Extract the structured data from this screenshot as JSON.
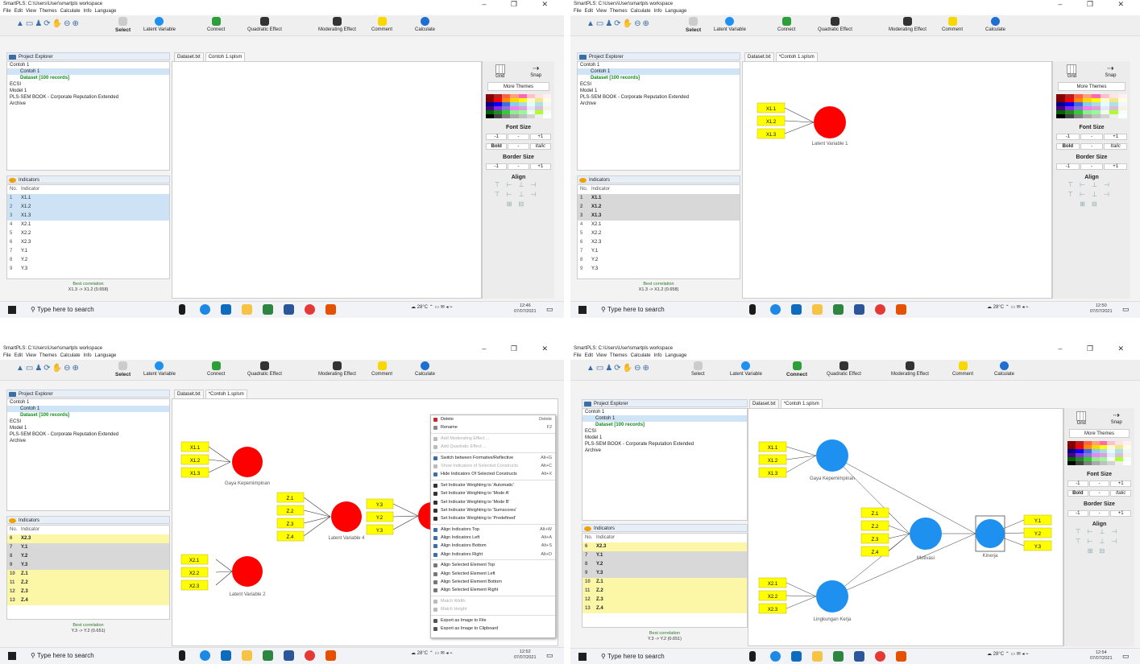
{
  "window": {
    "title": "SmartPLS: C:\\Users\\User\\smartpls workspace",
    "controls": "– ❐ ✕"
  },
  "menu": [
    "File",
    "Edit",
    "View",
    "Themes",
    "Calculate",
    "Info",
    "Language"
  ],
  "toolbar": {
    "select": "Select",
    "latent": "Latent Variable",
    "connect": "Connect",
    "quadratic": "Quadratic Effect",
    "moderating": "Moderating Effect",
    "comment": "Comment",
    "calculate": "Calculate"
  },
  "explorer": {
    "title": "Project Explorer",
    "items": [
      {
        "label": "Contoh 1",
        "cls": ""
      },
      {
        "label": "Contoh 1",
        "cls": "sel"
      },
      {
        "label": "Dataset [100 records]",
        "cls": "green"
      },
      {
        "label": "ECSI",
        "cls": ""
      },
      {
        "label": "Model 1",
        "cls": ""
      },
      {
        "label": "PLS-SEM BOOK - Corporate Reputation Extended",
        "cls": ""
      },
      {
        "label": "Archive",
        "cls": ""
      }
    ]
  },
  "indicators": {
    "title": "Indicators",
    "header_no": "No.",
    "header_label": "Indicator",
    "q1": [
      [
        "1",
        "X1.1",
        "bl"
      ],
      [
        "2",
        "X1.2",
        "bl"
      ],
      [
        "3",
        "X1.3",
        "bl"
      ],
      [
        "4",
        "X2.1",
        ""
      ],
      [
        "5",
        "X2.2",
        ""
      ],
      [
        "6",
        "X2.3",
        ""
      ],
      [
        "7",
        "Y.1",
        ""
      ],
      [
        "8",
        "Y.2",
        ""
      ],
      [
        "9",
        "Y.3",
        ""
      ]
    ],
    "q2": [
      [
        "1",
        "X1.1",
        "gr"
      ],
      [
        "2",
        "X1.2",
        "gr"
      ],
      [
        "3",
        "X1.3",
        "gr"
      ],
      [
        "4",
        "X2.1",
        ""
      ],
      [
        "5",
        "X2.2",
        ""
      ],
      [
        "6",
        "X2.3",
        ""
      ],
      [
        "7",
        "Y.1",
        ""
      ],
      [
        "8",
        "Y.2",
        ""
      ],
      [
        "9",
        "Y.3",
        ""
      ]
    ],
    "q3": [
      [
        "6",
        "X2.3",
        "ye"
      ],
      [
        "7",
        "Y.1",
        "gr"
      ],
      [
        "8",
        "Y.2",
        "gr"
      ],
      [
        "9",
        "Y.3",
        "gr"
      ],
      [
        "10",
        "Z.1",
        "ye"
      ],
      [
        "11",
        "Z.2",
        "ye"
      ],
      [
        "12",
        "Z.3",
        "ye"
      ],
      [
        "13",
        "Z.4",
        "ye"
      ]
    ],
    "q4": [
      [
        "6",
        "X2.3",
        "ye"
      ],
      [
        "7",
        "Y.1",
        "gr"
      ],
      [
        "8",
        "Y.2",
        "gr"
      ],
      [
        "9",
        "Y.3",
        "gr"
      ],
      [
        "10",
        "Z.1",
        "ye"
      ],
      [
        "11",
        "Z.2",
        "ye"
      ],
      [
        "12",
        "Z.3",
        "ye"
      ],
      [
        "13",
        "Z.4",
        "ye"
      ]
    ]
  },
  "best_correlation": {
    "label": "Best correlation",
    "v1": "X1.3 -> X1.2 (0.658)",
    "v2": "X1.3 -> X1.2 (0.658)",
    "v3": "Y.3 -> Y.2 (0.651)",
    "v4": "Y.3 -> Y.2 (0.651)"
  },
  "tabs": {
    "dataset": "Dataset.txt",
    "model1": "Contoh 1.splsm",
    "model2": "*Contoh 1.splsm"
  },
  "props": {
    "grid": "Grid",
    "snap": "Snap",
    "more_themes": "More Themes",
    "font_size": "Font Size",
    "border_size": "Border Size",
    "align": "Align",
    "bold": "Bold",
    "italic": "Italic",
    "minus": "-1",
    "dash": "-",
    "plus": "+1",
    "one": "1"
  },
  "model": {
    "lv1": "Latent Variable 1",
    "gaya": "Gaya Kepemimpinan",
    "lv4": "Latent Variable 4",
    "lv2": "Latent Variable 2",
    "motivasi": "Motivasi",
    "kinerja": "Kinerja",
    "lingkungan": "Lingkungan Kerja",
    "x1": [
      "X1.1",
      "X1.2",
      "X1.3"
    ],
    "x2": [
      "X2.1",
      "X2.2",
      "X2.3"
    ],
    "z": [
      "Z.1",
      "Z.2",
      "Z.3",
      "Z.4"
    ],
    "y": [
      "Y.1",
      "Y.2",
      "Y.3"
    ]
  },
  "context_menu": [
    {
      "label": "Delete",
      "sh": "Delete",
      "c": "#c62828",
      "dis": false,
      "sep": false
    },
    {
      "label": "Rename",
      "sh": "F2",
      "c": "#888",
      "dis": false,
      "sep": true
    },
    {
      "label": "Add Moderating Effect ...",
      "sh": "",
      "c": "#bbb",
      "dis": true,
      "sep": false
    },
    {
      "label": "Add Quadratic Effect ...",
      "sh": "",
      "c": "#bbb",
      "dis": true,
      "sep": true
    },
    {
      "label": "Switch between Formative/Reflective",
      "sh": "Alt+G",
      "c": "#3a6ea5",
      "dis": false,
      "sep": false
    },
    {
      "label": "Show Indicators of Selected Constructs",
      "sh": "Alt+C",
      "c": "#bbb",
      "dis": true,
      "sep": false
    },
    {
      "label": "Hide Indicators Of Selected Constructs",
      "sh": "Alt+X",
      "c": "#3a6ea5",
      "dis": false,
      "sep": true
    },
    {
      "label": "Set Indicator Weighting to 'Automatic'",
      "sh": "",
      "c": "#333",
      "dis": false,
      "sep": false
    },
    {
      "label": "Set Indicator Weighting to 'Mode A'",
      "sh": "",
      "c": "#333",
      "dis": false,
      "sep": false
    },
    {
      "label": "Set Indicator Weighting to 'Mode B'",
      "sh": "",
      "c": "#333",
      "dis": false,
      "sep": false
    },
    {
      "label": "Set Indicator Weighting to 'Sumscores'",
      "sh": "",
      "c": "#333",
      "dis": false,
      "sep": false
    },
    {
      "label": "Set Indicator Weighting to 'Predefined'",
      "sh": "",
      "c": "#333",
      "dis": false,
      "sep": true
    },
    {
      "label": "Align Indicators Top",
      "sh": "Alt+W",
      "c": "#3a6ea5",
      "dis": false,
      "sep": false
    },
    {
      "label": "Align Indicators Left",
      "sh": "Alt+A",
      "c": "#3a6ea5",
      "dis": false,
      "sep": false
    },
    {
      "label": "Align Indicators Bottom",
      "sh": "Alt+S",
      "c": "#3a6ea5",
      "dis": false,
      "sep": false
    },
    {
      "label": "Align Indicators Right",
      "sh": "Alt+D",
      "c": "#3a6ea5",
      "dis": false,
      "sep": true
    },
    {
      "label": "Align Selected Element Top",
      "sh": "",
      "c": "#777",
      "dis": false,
      "sep": false
    },
    {
      "label": "Align Selected Element Left",
      "sh": "",
      "c": "#777",
      "dis": false,
      "sep": false
    },
    {
      "label": "Align Selected Element Bottom",
      "sh": "",
      "c": "#777",
      "dis": false,
      "sep": false
    },
    {
      "label": "Align Selected Element Right",
      "sh": "",
      "c": "#777",
      "dis": false,
      "sep": true
    },
    {
      "label": "Match Width",
      "sh": "",
      "c": "#bbb",
      "dis": true,
      "sep": false
    },
    {
      "label": "Match Height",
      "sh": "",
      "c": "#bbb",
      "dis": true,
      "sep": true
    },
    {
      "label": "Export as Image to File",
      "sh": "",
      "c": "#555",
      "dis": false,
      "sep": false
    },
    {
      "label": "Export as Image to Clipboard",
      "sh": "",
      "c": "#555",
      "dis": false,
      "sep": false
    }
  ],
  "taskbar": {
    "search": "Type here to search",
    "temp": "28°C",
    "t1": "12:46",
    "t2": "12:50",
    "t3": "12:52",
    "t4": "12:54",
    "date": "07/07/2021"
  },
  "colors": {
    "red": "#ff0000",
    "blue": "#1e90f0",
    "yellow": "#ffff00",
    "accent": "#3a6ea5"
  }
}
